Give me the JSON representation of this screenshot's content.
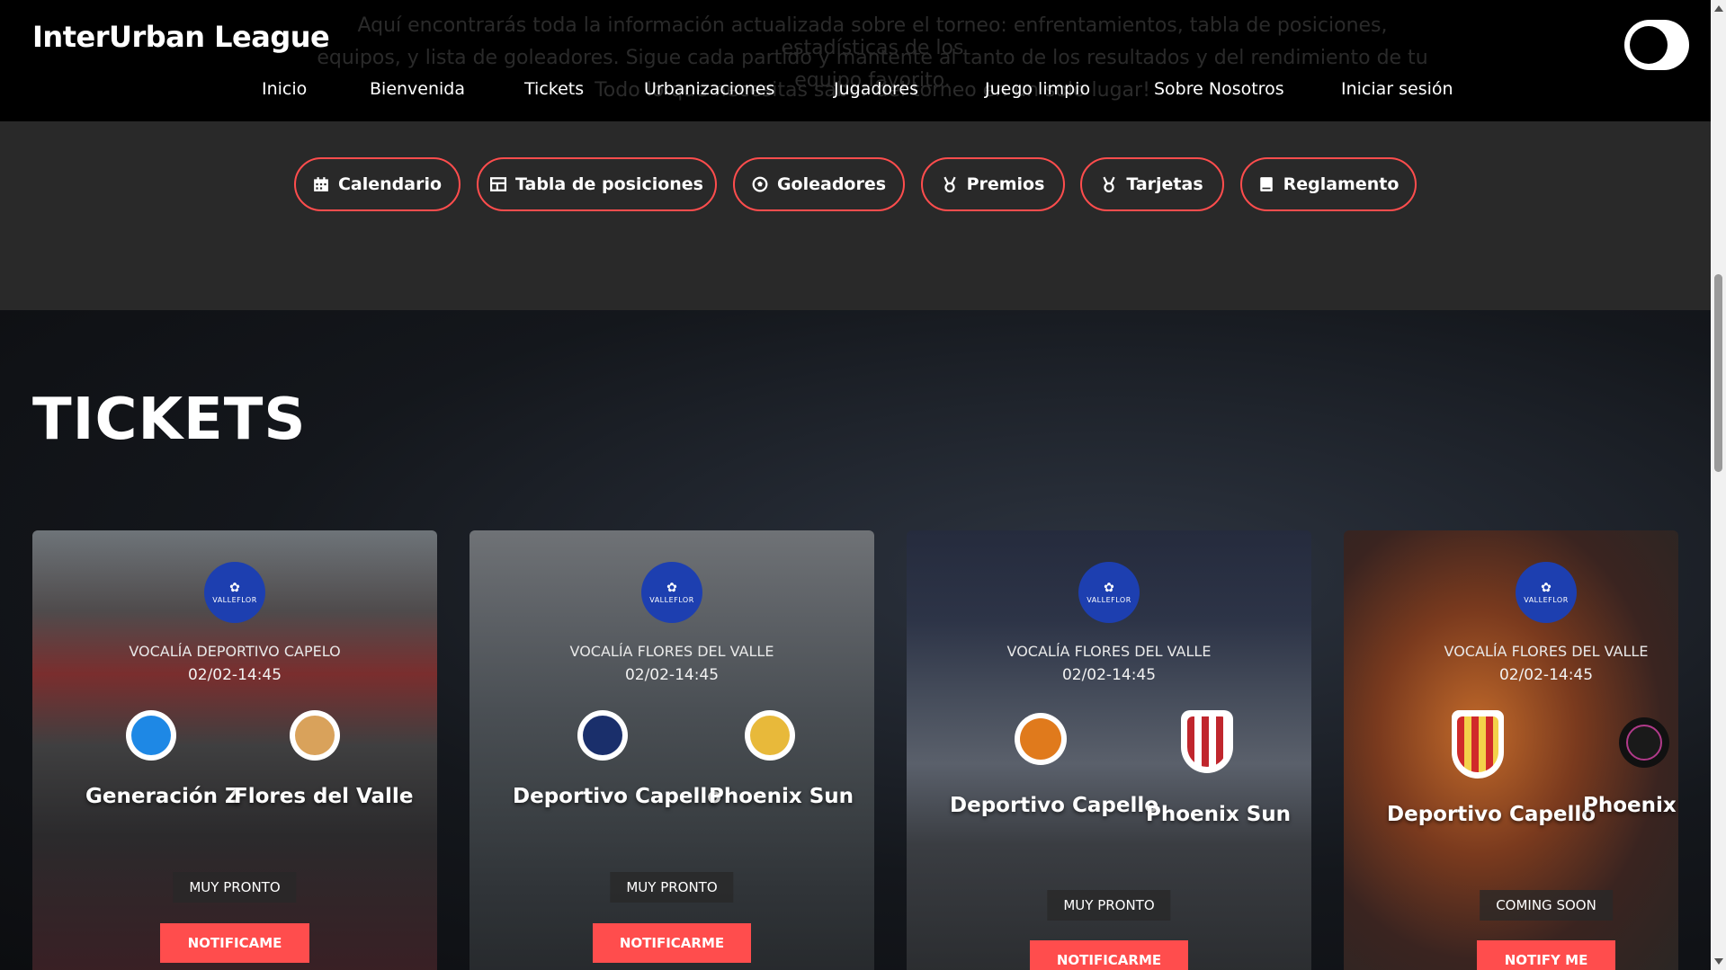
{
  "header": {
    "brand": "InterUrban League",
    "ghost_text": [
      "Aquí encontrarás toda la información actualizada sobre el torneo: enfrentamientos, tabla de posiciones, estadísticas de los",
      "equipos, y lista de goleadores. Sigue cada partido y mantente al tanto de los resultados y del rendimiento de tu equipo favorito.",
      "Todo lo que necesitas saber del torneo en un solo lugar!"
    ],
    "nav": [
      "Inicio",
      "Bienvenida",
      "Tickets",
      "Urbanizaciones",
      "Jugadores",
      "Juego limpio",
      "Sobre Nosotros",
      "Iniciar sesión"
    ]
  },
  "quick_links": [
    {
      "label": "Calendario",
      "icon": "calendar-icon"
    },
    {
      "label": "Tabla de posiciones",
      "icon": "table-icon"
    },
    {
      "label": "Goleadores",
      "icon": "soccer-ball-icon"
    },
    {
      "label": "Premios",
      "icon": "medal-icon"
    },
    {
      "label": "Tarjetas",
      "icon": "medal-icon"
    },
    {
      "label": "Reglamento",
      "icon": "book-icon"
    }
  ],
  "tickets": {
    "title": "TICKETS",
    "league_badge": "VALLEFLOR",
    "cards": [
      {
        "vocalia": "VOCALÍA DEPORTIVO CAPELO",
        "datetime": "02/02-14:45",
        "home": "Generación Z",
        "away": "Flores del Valle",
        "status": "MUY PRONTO",
        "button": "NOTIFICAME"
      },
      {
        "vocalia": "VOCALÍA FLORES DEL VALLE",
        "datetime": "02/02-14:45",
        "home": "Deportivo Capello",
        "away": "Phoenix Sun",
        "status": "MUY PRONTO",
        "button": "NOTIFICARME"
      },
      {
        "vocalia": "VOCALÍA FLORES DEL VALLE",
        "datetime": "02/02-14:45",
        "home": "Deportivo Capello",
        "away": "Phoenix Sun",
        "status": "MUY PRONTO",
        "button": "NOTIFICARME"
      },
      {
        "vocalia": "VOCALÍA FLORES DEL VALLE",
        "datetime": "02/02-14:45",
        "home": "Deportivo Capello",
        "away": "Phoenix S",
        "status": "COMING SOON",
        "button": "NOTIFY ME"
      }
    ]
  },
  "colors": {
    "accent": "#ff4d4d",
    "header_bg": "#000000",
    "band_bg": "#292929",
    "league_badge": "#1d3fb0"
  }
}
